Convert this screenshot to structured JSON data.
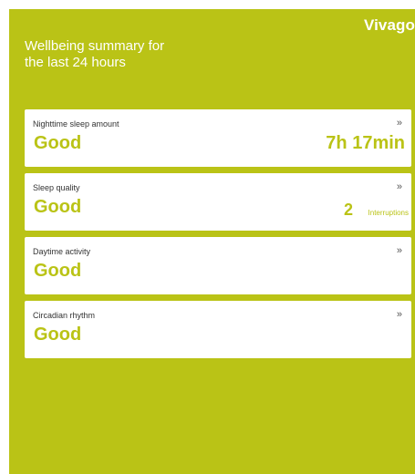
{
  "brand": "Vivago",
  "summary_title": "Wellbeing summary for the last 24 hours",
  "accent_color": "#bac316",
  "arrow_icon": "double-chevron-right-icon",
  "cards": [
    {
      "label": "Nighttime sleep amount",
      "arrow": "»",
      "status": "Good",
      "value": "7h 17min"
    },
    {
      "label": "Sleep quality",
      "arrow": "»",
      "status": "Good",
      "value_number": "2",
      "value_unit": "Interruptions"
    },
    {
      "label": "Daytime activity",
      "arrow": "»",
      "status": "Good"
    },
    {
      "label": "Circadian rhythm",
      "arrow": "»",
      "status": "Good"
    }
  ]
}
